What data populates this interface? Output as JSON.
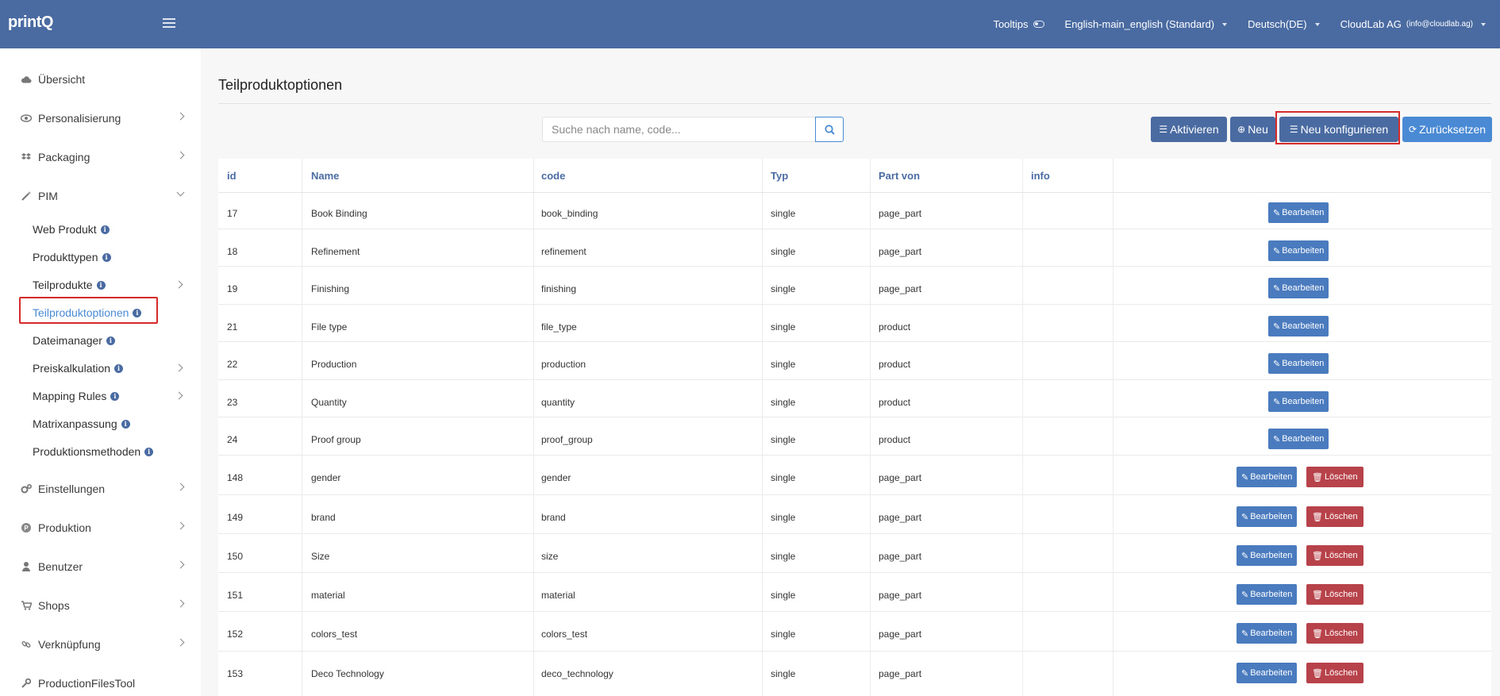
{
  "app": {
    "logo": "printQ"
  },
  "topbar": {
    "tooltips_label": "Tooltips",
    "language_set": "English-main_english (Standard)",
    "locale": "Deutsch(DE)",
    "company": "CloudLab AG",
    "email": "(info@cloudlab.ag)"
  },
  "sidebar": {
    "items": [
      {
        "label": "Übersicht",
        "icon": "cloud-icon"
      },
      {
        "label": "Personalisierung",
        "icon": "eye-icon"
      },
      {
        "label": "Packaging",
        "icon": "dropbox-icon"
      },
      {
        "label": "PIM",
        "icon": "wand-icon"
      },
      {
        "label": "Einstellungen",
        "icon": "gears-icon"
      },
      {
        "label": "Produktion",
        "icon": "p-circle-icon"
      },
      {
        "label": "Benutzer",
        "icon": "user-icon"
      },
      {
        "label": "Shops",
        "icon": "cart-icon"
      },
      {
        "label": "Verknüpfung",
        "icon": "link-icon"
      },
      {
        "label": "ProductionFilesTool",
        "icon": "wrench-icon"
      }
    ],
    "pim_sub": [
      {
        "label": "Web Produkt"
      },
      {
        "label": "Produkttypen"
      },
      {
        "label": "Teilprodukte"
      },
      {
        "label": "Teilproduktoptionen"
      },
      {
        "label": "Dateimanager"
      },
      {
        "label": "Preiskalkulation"
      },
      {
        "label": "Mapping Rules"
      },
      {
        "label": "Matrixanpassung"
      },
      {
        "label": "Produktionsmethoden"
      }
    ]
  },
  "main": {
    "title": "Teilproduktoptionen",
    "search_placeholder": "Suche nach name, code...",
    "buttons": {
      "aktivieren": "Aktivieren",
      "neu": "Neu",
      "neu_konfigurieren": "Neu konfigurieren",
      "zuruecksetzen": "Zurücksetzen"
    },
    "columns": [
      "id",
      "Name",
      "code",
      "Typ",
      "Part von",
      "info"
    ],
    "edit_label": "Bearbeiten",
    "delete_label": "Löschen",
    "rows": [
      {
        "id": "17",
        "name": "Book Binding",
        "code": "book_binding",
        "typ": "single",
        "part": "page_part"
      },
      {
        "id": "18",
        "name": "Refinement",
        "code": "refinement",
        "typ": "single",
        "part": "page_part"
      },
      {
        "id": "19",
        "name": "Finishing",
        "code": "finishing",
        "typ": "single",
        "part": "page_part"
      },
      {
        "id": "21",
        "name": "File type",
        "code": "file_type",
        "typ": "single",
        "part": "product"
      },
      {
        "id": "22",
        "name": "Production",
        "code": "production",
        "typ": "single",
        "part": "product"
      },
      {
        "id": "23",
        "name": "Quantity",
        "code": "quantity",
        "typ": "single",
        "part": "product"
      },
      {
        "id": "24",
        "name": "Proof group",
        "code": "proof_group",
        "typ": "single",
        "part": "product"
      },
      {
        "id": "148",
        "name": "gender",
        "code": "gender",
        "typ": "single",
        "part": "page_part"
      },
      {
        "id": "149",
        "name": "brand",
        "code": "brand",
        "typ": "single",
        "part": "page_part"
      },
      {
        "id": "150",
        "name": "Size",
        "code": "size",
        "typ": "single",
        "part": "page_part"
      },
      {
        "id": "151",
        "name": "material",
        "code": "material",
        "typ": "single",
        "part": "page_part"
      },
      {
        "id": "152",
        "name": "colors_test",
        "code": "colors_test",
        "typ": "single",
        "part": "page_part"
      },
      {
        "id": "153",
        "name": "Deco Technology",
        "code": "deco_technology",
        "typ": "single",
        "part": "page_part"
      }
    ]
  },
  "colors": {
    "topbar": "#4a6ba2",
    "accent": "#4a8ad4",
    "danger": "#b8424a",
    "highlight": "#d42a2a"
  }
}
